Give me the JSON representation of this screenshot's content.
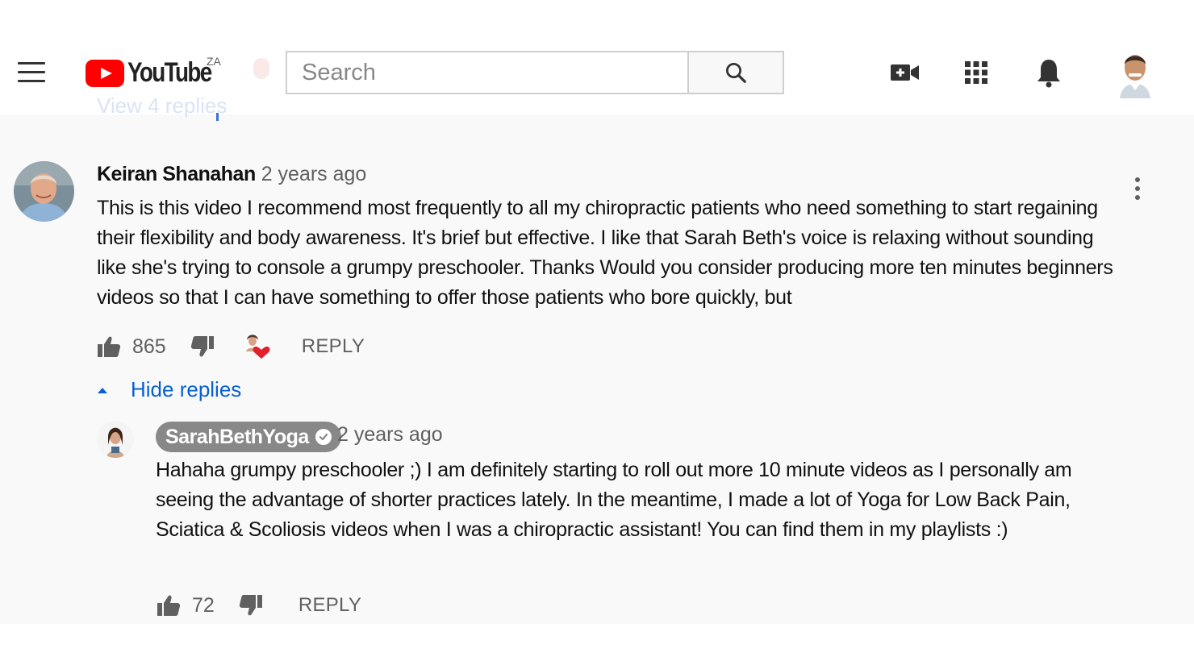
{
  "header": {
    "logo_text": "YouTube",
    "region": "ZA",
    "search_placeholder": "Search",
    "icons": [
      "menu-icon",
      "search-icon",
      "create-video-icon",
      "apps-icon",
      "notifications-icon"
    ]
  },
  "faded_row": {
    "text": "View 4 replies"
  },
  "comment": {
    "author": "Keiran Shanahan",
    "time": "2 years ago",
    "text": "This is this video I recommend most frequently to all my chiropractic patients who need something to start regaining their flexibility and body awareness. It's brief but effective. I like that Sarah Beth's voice is relaxing without sounding like she's trying to console a grumpy preschooler. Thanks   Would you consider producing more ten minutes beginners videos so that I can have something to offer those patients who bore quickly, but",
    "likes": "865",
    "reply_label": "REPLY",
    "hide_replies_label": "Hide replies"
  },
  "reply": {
    "author": "SarahBethYoga",
    "time": "2 years ago",
    "text": "Hahaha grumpy preschooler ;) I am definitely starting to roll out more 10 minute videos as I personally am seeing the advantage of shorter practices lately. In the meantime, I made a lot of Yoga for Low Back Pain, Sciatica & Scoliosis videos when I was a chiropractic assistant! You can find them in my playlists :)",
    "likes": "72",
    "reply_label": "REPLY"
  },
  "colors": {
    "youtube_red": "#ff0000",
    "link_blue": "#065fd4",
    "heart_red": "#e0202a",
    "channel_badge": "#888888"
  }
}
